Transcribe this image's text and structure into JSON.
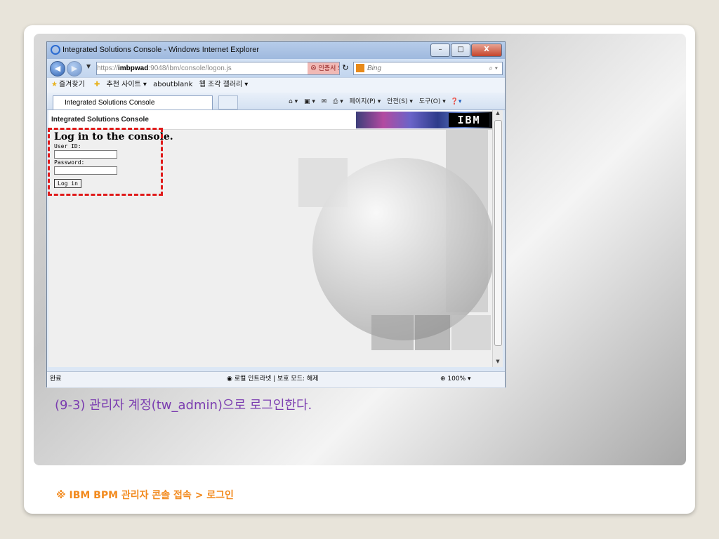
{
  "window": {
    "title": "Integrated Solutions Console - Windows Internet Explorer",
    "buttons": {
      "minimize": "–",
      "maximize": "□",
      "close": "X"
    }
  },
  "address": {
    "prefix": "https://",
    "host": "imbpwad",
    "rest": ":9048/ibm/console/logon.js",
    "cert_error": "인증서 오류",
    "search_placeholder": "Bing"
  },
  "favorites": {
    "label": "즐겨찾기",
    "items": [
      "추천 사이트 ▾",
      "aboutblank",
      "웹 조각 갤러리 ▾"
    ]
  },
  "tab": {
    "title": "Integrated Solutions Console"
  },
  "command_bar": {
    "page": "페이지(P) ▾",
    "safety": "안전(S) ▾",
    "tools": "도구(O) ▾"
  },
  "console": {
    "header_title": "Integrated Solutions Console",
    "ibm_logo": "IBM",
    "login": {
      "heading": "Log in to the console.",
      "userid_label": "User ID:",
      "userid_value": "",
      "password_label": "Password:",
      "button": "Log in"
    }
  },
  "statusbar": {
    "left": "완료",
    "zone": "로컬 인트라넷 | 보호 모드: 해제",
    "zoom": "100%"
  },
  "slide": {
    "caption": "(9-3) 관리자 계정(tw_admin)으로 로그인한다.",
    "footer": "※ IBM BPM 관리자 콘솔 접속 > 로그인"
  }
}
